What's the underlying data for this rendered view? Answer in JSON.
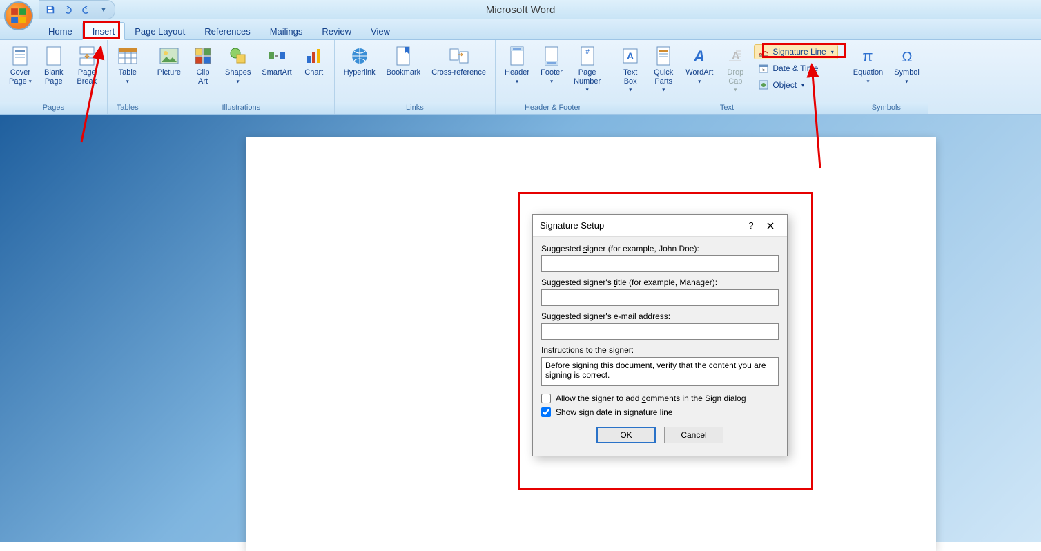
{
  "app_title": "Microsoft Word",
  "tabs": {
    "home": "Home",
    "insert": "Insert",
    "page_layout": "Page Layout",
    "references": "References",
    "mailings": "Mailings",
    "review": "Review",
    "view": "View"
  },
  "ribbon": {
    "pages": {
      "label": "Pages",
      "cover_page": "Cover\nPage",
      "blank_page": "Blank\nPage",
      "page_break": "Page\nBreak"
    },
    "tables": {
      "label": "Tables",
      "table": "Table"
    },
    "illustrations": {
      "label": "Illustrations",
      "picture": "Picture",
      "clip_art": "Clip\nArt",
      "shapes": "Shapes",
      "smartart": "SmartArt",
      "chart": "Chart"
    },
    "links": {
      "label": "Links",
      "hyperlink": "Hyperlink",
      "bookmark": "Bookmark",
      "cross_reference": "Cross-reference"
    },
    "header_footer": {
      "label": "Header & Footer",
      "header": "Header",
      "footer": "Footer",
      "page_number": "Page\nNumber"
    },
    "text": {
      "label": "Text",
      "text_box": "Text\nBox",
      "quick_parts": "Quick\nParts",
      "wordart": "WordArt",
      "drop_cap": "Drop\nCap",
      "signature_line": "Signature Line",
      "date_time": "Date & Time",
      "object": "Object"
    },
    "symbols": {
      "label": "Symbols",
      "equation": "Equation",
      "symbol": "Symbol"
    }
  },
  "dialog": {
    "title": "Signature Setup",
    "signer_label_pre": "Suggested ",
    "signer_label_u": "s",
    "signer_label_post": "igner (for example, John Doe):",
    "signer_val": "",
    "title_label_pre": "Suggested signer's ",
    "title_label_u": "t",
    "title_label_post": "itle (for example, Manager):",
    "title_val": "",
    "email_label_pre": "Suggested signer's ",
    "email_label_u": "e",
    "email_label_post": "-mail address:",
    "email_val": "",
    "instr_label_pre": "",
    "instr_label_u": "I",
    "instr_label_post": "nstructions to the signer:",
    "instr_val": "Before signing this document, verify that the content you are signing is correct.",
    "chk_comments_pre": "Allow the signer to add ",
    "chk_comments_u": "c",
    "chk_comments_post": "omments in the Sign dialog",
    "chk_date_pre": "Show sign ",
    "chk_date_u": "d",
    "chk_date_post": "ate in signature line",
    "ok": "OK",
    "cancel": "Cancel"
  }
}
